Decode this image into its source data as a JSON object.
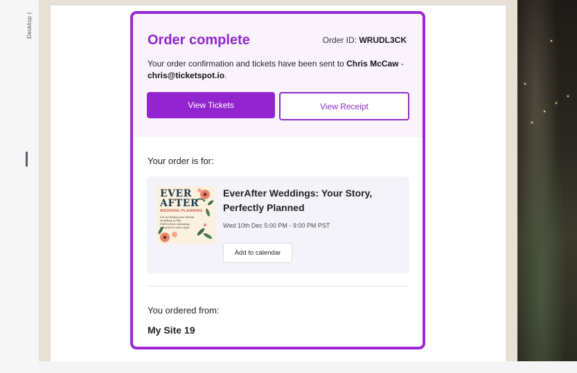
{
  "editor": {
    "device_label": "Desktop ("
  },
  "order": {
    "title": "Order complete",
    "order_id_label": "Order ID:",
    "order_id": "WRUDL3CK",
    "confirmation_prefix": "Your order confirmation and tickets have been sent to",
    "customer_name": "Chris McCaw",
    "separator": " - ",
    "customer_email": "chris@ticketspot.io",
    "period": ".",
    "view_tickets_label": "View Tickets",
    "view_receipt_label": "View Receipt"
  },
  "event": {
    "section_label": "Your order is for:",
    "title": "EverAfter Weddings: Your Story, Perfectly Planned",
    "date": "Wed 10th Dec 5:00 PM - 9:00 PM PST",
    "add_to_calendar_label": "Add to calendar",
    "thumbnail": {
      "line1": "EVER",
      "line2": "AFTER",
      "subtitle": "WEDDING PLANNING",
      "body1": "Let us bring your dream wedding to life.",
      "body2": "Full-service planning tailored to your style."
    }
  },
  "seller": {
    "section_label": "You ordered from:",
    "name": "My Site 19"
  },
  "colors": {
    "accent": "#9225cf",
    "hero_bg": "#faf3fe",
    "canvas_bg": "#e6e1d4"
  }
}
